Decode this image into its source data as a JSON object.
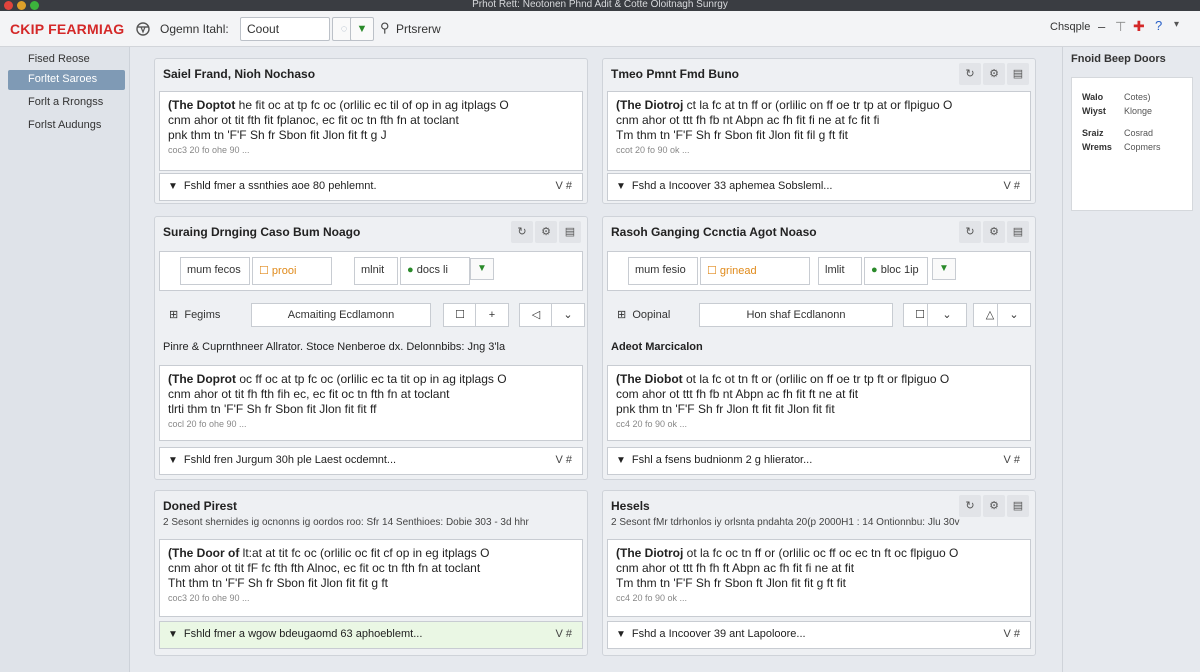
{
  "window": {
    "title": "Prhot Rett: Neotonen Phnd Adit & Cotte Oloitnagh Sunrgy"
  },
  "toolbar": {
    "brand": "CKIP FEARMIAG",
    "filter_label": "Ogemn Itahl:",
    "combo_value": "Coout",
    "preview_label": "Prtsrerw",
    "right_label": "Chsqple"
  },
  "sidebar": {
    "items": [
      {
        "label": "Fised Reose"
      },
      {
        "label": "Forltet Saroes"
      },
      {
        "label": "Forlt a Rrongss"
      },
      {
        "label": "Forlst Audungs"
      }
    ]
  },
  "right_panel": {
    "title": "Fnoid Beep Doors",
    "rows": [
      {
        "key": "Walo",
        "value": "Cotes)"
      },
      {
        "key": "Wiyst",
        "value": "Klonge"
      },
      {
        "key": "Sraiz",
        "value": "Cosrad"
      },
      {
        "key": "Wrems",
        "value": "Copmers"
      }
    ]
  },
  "panels": [
    {
      "title": "Saiel Frand, Nioh Nochaso",
      "textbox": {
        "lead": "(The Doptot",
        "line1": " he fit oc at tp fc oc (orlilic ec til of op in ag itplags O",
        "line2": "cnm ahor ot tit fth fit fplanoc, ec fit oc tn fth fn at toclant",
        "line3": "pnk thm tn 'F'F Sh fr Sbon fit Jlon fit ft g J",
        "meta": "coc3 20 fo ohe 90 ..."
      },
      "footer": "Fshld fmer a ssnthies aoe 80 pehlemnt.",
      "footer_right": "V #"
    },
    {
      "title": "Tmeo Pmnt Fmd Buno",
      "textbox": {
        "lead": "(The Diotroj",
        "line1": " ct la fc at tn ff or (orlilic on ff oe tr tp at or flpiguo O",
        "line2": "cnm ahor ot ttt fh fb nt Abpn ac fh fit fi ne at fc fit fi",
        "line3": "Tm thm tn 'F'F Sh fr Sbon fit Jlon fit fil g ft fit",
        "meta": "ccot 20 fo 90 ok ..."
      },
      "footer": "Fshd a Incoover 33 aphemea Sobsleml...",
      "footer_right": "V #"
    },
    {
      "title": "Suraing Drnging Caso Bum Noago",
      "ctrl": {
        "seg1": "mum fecos",
        "seg2": "prooi",
        "seg3": "mlnit",
        "seg4": "docs li"
      },
      "subrow": {
        "label": "Fegims",
        "field": "Acmaiting Ecdlamonn"
      },
      "section": "Pinre & Cuprnthneer Allrator. Stoce Nenberoe dx. Delonnbibs: Jng 3'la",
      "textbox": {
        "lead": "(The Doprot",
        "line1": " oc ff oc at tp fc oc (orlilic ec ta tit op in ag itplags O",
        "line2": "cnm ahor ot tit fh fth fih ec, ec fit oc tn fth fn at toclant",
        "line3": "tlrti thm tn 'F'F Sh fr Sbon fit Jlon fit fit ff",
        "meta": "cocl 20 fo ohe 90 ..."
      },
      "footer": "Fshld fren Jurgum 30h ple Laest ocdemnt...",
      "footer_right": "V #"
    },
    {
      "title": "Rasoh Ganging Ccnctia Agot Noaso",
      "ctrl": {
        "seg1": "mum fesio",
        "seg2": "grinead",
        "seg3": "lmlit",
        "seg4": "bloc 1ip"
      },
      "subrow": {
        "label": "Oopinal",
        "field": "Hon shaf Ecdlanonn"
      },
      "section": "Adeot Marcicalon",
      "textbox": {
        "lead": "(The Diobot",
        "line1": " ot la fc ot tn ft or (orlilic on ff oe tr tp ft or flpiguo O",
        "line2": "com ahor ot ttt fh fb nt Abpn ac fh fit ft ne at fit",
        "line3": "pnk thm tn 'F'F Sh fr Jlon ft fit fit Jlon fit fit",
        "meta": "cc4 20 fo 90 ok ..."
      },
      "footer": "Fshl a fsens budnionm 2 g hlierator...",
      "footer_right": "V #"
    },
    {
      "title": "Doned Pirest",
      "meta": "2 Sesont shernides ig ocnonns ig oordos roo: Sfr 14 Senthioes: Dobie 303 - 3d hhr",
      "textbox": {
        "lead": "(The Door of",
        "line1": " lt:at at tit fc oc (orlilic oc fit cf op in eg itplags O",
        "line2": "cnm ahor ot tit fF fc fth fth Alnoc, ec fit oc tn fth fn at toclant",
        "line3": "Tht thm tn 'F'F Sh fr Sbon fit Jlon fit fit g ft",
        "meta": "coc3 20 fo ohe 90 ..."
      },
      "footer": "Fshld fmer a wgow bdeugaomd 63 aphoeblemt...",
      "footer_right": "V #"
    },
    {
      "title": "Hesels",
      "meta": "2 Sesont fMr tdrhonlos iy orlsnta pndahta 20(p 2000H1 : 14 Ontionnbu: Jlu 30v",
      "textbox": {
        "lead": "(The Diotroj",
        "line1": " ot la fc oc tn ff or (orlilic oc ff oc ec tn ft oc flpiguo O",
        "line2": "cnm ahor ot ttt fh fh ft Abpn ac fh fit fi ne at fit",
        "line3": "Tm thm tn 'F'F Sh fr Sbon ft Jlon fit fit g ft fit",
        "meta": "cc4 20 fo 90 ok ..."
      },
      "footer": "Fshd a Incoover 39 ant Lapoloore...",
      "footer_right": "V #"
    }
  ]
}
